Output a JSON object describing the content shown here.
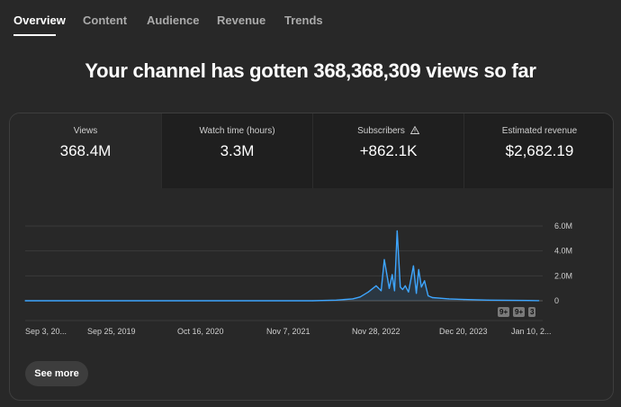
{
  "tabs": [
    {
      "label": "Overview",
      "active": true
    },
    {
      "label": "Content",
      "active": false
    },
    {
      "label": "Audience",
      "active": false
    },
    {
      "label": "Revenue",
      "active": false
    },
    {
      "label": "Trends",
      "active": false
    }
  ],
  "headline": "Your channel has gotten 368,368,309 views so far",
  "metrics": [
    {
      "label": "Views",
      "value": "368.4M"
    },
    {
      "label": "Watch time (hours)",
      "value": "3.3M"
    },
    {
      "label": "Subscribers",
      "value": "+862.1K",
      "icon": "warning-icon"
    },
    {
      "label": "Estimated revenue",
      "value": "$2,682.19"
    }
  ],
  "chart_data": {
    "type": "line",
    "series_color": "#3ea6ff",
    "y_tick_labels": [
      "6.0M",
      "4.0M",
      "2.0M",
      "0"
    ],
    "ylim": [
      0,
      6000000
    ],
    "x_tick_labels": [
      "Sep 3, 20...",
      "Sep 25, 2019",
      "Oct 16, 2020",
      "Nov 7, 2021",
      "Nov 28, 2022",
      "Dec 20, 2023",
      "Jan 10, 2..."
    ],
    "x": [
      "2018-09-03",
      "2021-09-01",
      "2021-12-01",
      "2022-02-01",
      "2022-03-01",
      "2022-04-01",
      "2022-05-01",
      "2022-05-20",
      "2022-06-01",
      "2022-06-20",
      "2022-07-01",
      "2022-07-10",
      "2022-07-20",
      "2022-08-01",
      "2022-08-10",
      "2022-08-20",
      "2022-09-01",
      "2022-09-20",
      "2022-10-01",
      "2022-10-10",
      "2022-10-20",
      "2022-11-01",
      "2022-11-15",
      "2022-12-01",
      "2023-01-01",
      "2023-02-01",
      "2023-04-01",
      "2023-07-01",
      "2023-12-01",
      "2024-01-10"
    ],
    "y": [
      0,
      0,
      50000,
      150000,
      300000,
      700000,
      1200000,
      800000,
      3300000,
      1000000,
      2100000,
      800000,
      5600000,
      1100000,
      900000,
      1200000,
      700000,
      2800000,
      600000,
      2500000,
      1100000,
      1600000,
      400000,
      250000,
      200000,
      150000,
      100000,
      50000,
      20000,
      10000
    ],
    "grid": true,
    "badges": [
      "9+",
      "9+",
      "3"
    ]
  },
  "see_more": "See more"
}
